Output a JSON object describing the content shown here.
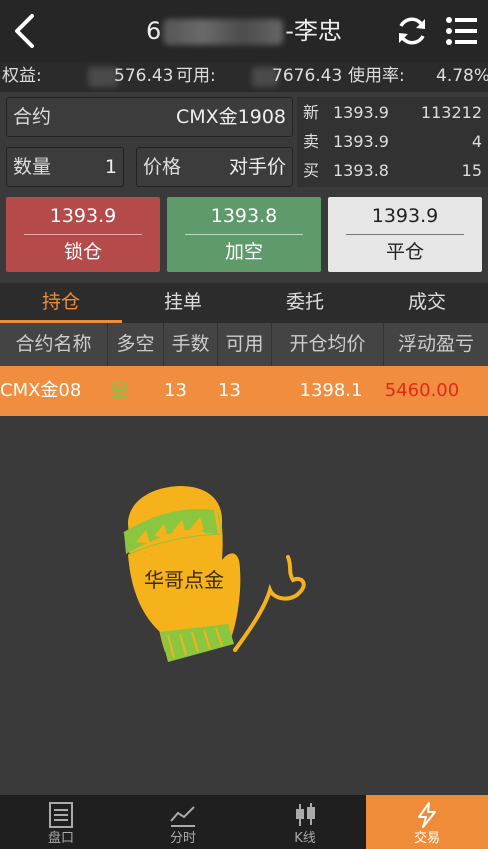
{
  "header": {
    "title_prefix": "6",
    "title_suffix": "-李忠"
  },
  "account": {
    "equity_label": "权益:",
    "equity_value": "576.43",
    "available_label": "可用:",
    "available_value": "7676.43",
    "usage_label": "使用率:",
    "usage_value": "4.78%"
  },
  "order": {
    "contract_label": "合约",
    "contract_value": "CMX金1908",
    "qty_label": "数量",
    "qty_value": "1",
    "price_label": "价格",
    "price_value": "对手价"
  },
  "quote": [
    {
      "key": "新",
      "price": "1393.9",
      "vol": "113212"
    },
    {
      "key": "卖",
      "price": "1393.9",
      "vol": "4"
    },
    {
      "key": "买",
      "price": "1393.8",
      "vol": "15"
    }
  ],
  "buttons": {
    "lock": {
      "price": "1393.9",
      "label": "锁仓"
    },
    "short": {
      "price": "1393.8",
      "label": "加空"
    },
    "close": {
      "price": "1393.9",
      "label": "平仓"
    }
  },
  "tabs": [
    "持仓",
    "挂单",
    "委托",
    "成交"
  ],
  "table": {
    "headers": [
      "合约名称",
      "多空",
      "手数",
      "可用",
      "开仓均价",
      "浮动盈亏"
    ],
    "rows": [
      {
        "name": "CMX金08",
        "dir": "空",
        "lots": "13",
        "avail": "13",
        "avg": "1398.1",
        "pnl": "5460.00"
      }
    ]
  },
  "logo": {
    "text": "华哥点金"
  },
  "nav": [
    "盘口",
    "分时",
    "K线",
    "交易"
  ],
  "colors": {
    "accent": "#ef8c3a",
    "lock_btn": "#b54a4a",
    "short_btn": "#5e9a6a",
    "close_btn": "#e6e6e6",
    "profit": "#e02a1a",
    "short_dir": "#6fd04a"
  }
}
